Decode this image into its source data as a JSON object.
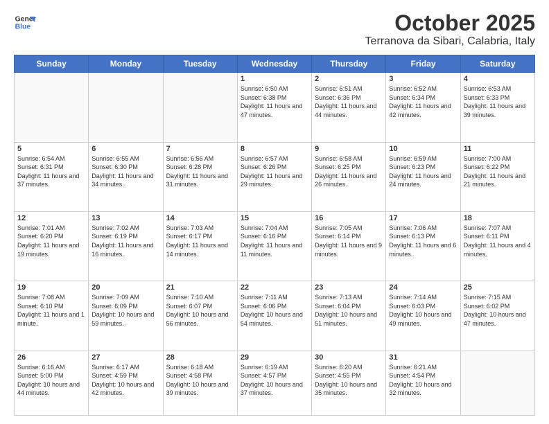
{
  "header": {
    "logo_line1": "General",
    "logo_line2": "Blue",
    "month": "October 2025",
    "location": "Terranova da Sibari, Calabria, Italy"
  },
  "days_of_week": [
    "Sunday",
    "Monday",
    "Tuesday",
    "Wednesday",
    "Thursday",
    "Friday",
    "Saturday"
  ],
  "weeks": [
    [
      {
        "day": "",
        "text": ""
      },
      {
        "day": "",
        "text": ""
      },
      {
        "day": "",
        "text": ""
      },
      {
        "day": "1",
        "text": "Sunrise: 6:50 AM\nSunset: 6:38 PM\nDaylight: 11 hours and 47 minutes."
      },
      {
        "day": "2",
        "text": "Sunrise: 6:51 AM\nSunset: 6:36 PM\nDaylight: 11 hours and 44 minutes."
      },
      {
        "day": "3",
        "text": "Sunrise: 6:52 AM\nSunset: 6:34 PM\nDaylight: 11 hours and 42 minutes."
      },
      {
        "day": "4",
        "text": "Sunrise: 6:53 AM\nSunset: 6:33 PM\nDaylight: 11 hours and 39 minutes."
      }
    ],
    [
      {
        "day": "5",
        "text": "Sunrise: 6:54 AM\nSunset: 6:31 PM\nDaylight: 11 hours and 37 minutes."
      },
      {
        "day": "6",
        "text": "Sunrise: 6:55 AM\nSunset: 6:30 PM\nDaylight: 11 hours and 34 minutes."
      },
      {
        "day": "7",
        "text": "Sunrise: 6:56 AM\nSunset: 6:28 PM\nDaylight: 11 hours and 31 minutes."
      },
      {
        "day": "8",
        "text": "Sunrise: 6:57 AM\nSunset: 6:26 PM\nDaylight: 11 hours and 29 minutes."
      },
      {
        "day": "9",
        "text": "Sunrise: 6:58 AM\nSunset: 6:25 PM\nDaylight: 11 hours and 26 minutes."
      },
      {
        "day": "10",
        "text": "Sunrise: 6:59 AM\nSunset: 6:23 PM\nDaylight: 11 hours and 24 minutes."
      },
      {
        "day": "11",
        "text": "Sunrise: 7:00 AM\nSunset: 6:22 PM\nDaylight: 11 hours and 21 minutes."
      }
    ],
    [
      {
        "day": "12",
        "text": "Sunrise: 7:01 AM\nSunset: 6:20 PM\nDaylight: 11 hours and 19 minutes."
      },
      {
        "day": "13",
        "text": "Sunrise: 7:02 AM\nSunset: 6:19 PM\nDaylight: 11 hours and 16 minutes."
      },
      {
        "day": "14",
        "text": "Sunrise: 7:03 AM\nSunset: 6:17 PM\nDaylight: 11 hours and 14 minutes."
      },
      {
        "day": "15",
        "text": "Sunrise: 7:04 AM\nSunset: 6:16 PM\nDaylight: 11 hours and 11 minutes."
      },
      {
        "day": "16",
        "text": "Sunrise: 7:05 AM\nSunset: 6:14 PM\nDaylight: 11 hours and 9 minutes."
      },
      {
        "day": "17",
        "text": "Sunrise: 7:06 AM\nSunset: 6:13 PM\nDaylight: 11 hours and 6 minutes."
      },
      {
        "day": "18",
        "text": "Sunrise: 7:07 AM\nSunset: 6:11 PM\nDaylight: 11 hours and 4 minutes."
      }
    ],
    [
      {
        "day": "19",
        "text": "Sunrise: 7:08 AM\nSunset: 6:10 PM\nDaylight: 11 hours and 1 minute."
      },
      {
        "day": "20",
        "text": "Sunrise: 7:09 AM\nSunset: 6:09 PM\nDaylight: 10 hours and 59 minutes."
      },
      {
        "day": "21",
        "text": "Sunrise: 7:10 AM\nSunset: 6:07 PM\nDaylight: 10 hours and 56 minutes."
      },
      {
        "day": "22",
        "text": "Sunrise: 7:11 AM\nSunset: 6:06 PM\nDaylight: 10 hours and 54 minutes."
      },
      {
        "day": "23",
        "text": "Sunrise: 7:13 AM\nSunset: 6:04 PM\nDaylight: 10 hours and 51 minutes."
      },
      {
        "day": "24",
        "text": "Sunrise: 7:14 AM\nSunset: 6:03 PM\nDaylight: 10 hours and 49 minutes."
      },
      {
        "day": "25",
        "text": "Sunrise: 7:15 AM\nSunset: 6:02 PM\nDaylight: 10 hours and 47 minutes."
      }
    ],
    [
      {
        "day": "26",
        "text": "Sunrise: 6:16 AM\nSunset: 5:00 PM\nDaylight: 10 hours and 44 minutes."
      },
      {
        "day": "27",
        "text": "Sunrise: 6:17 AM\nSunset: 4:59 PM\nDaylight: 10 hours and 42 minutes."
      },
      {
        "day": "28",
        "text": "Sunrise: 6:18 AM\nSunset: 4:58 PM\nDaylight: 10 hours and 39 minutes."
      },
      {
        "day": "29",
        "text": "Sunrise: 6:19 AM\nSunset: 4:57 PM\nDaylight: 10 hours and 37 minutes."
      },
      {
        "day": "30",
        "text": "Sunrise: 6:20 AM\nSunset: 4:55 PM\nDaylight: 10 hours and 35 minutes."
      },
      {
        "day": "31",
        "text": "Sunrise: 6:21 AM\nSunset: 4:54 PM\nDaylight: 10 hours and 32 minutes."
      },
      {
        "day": "",
        "text": ""
      }
    ]
  ]
}
